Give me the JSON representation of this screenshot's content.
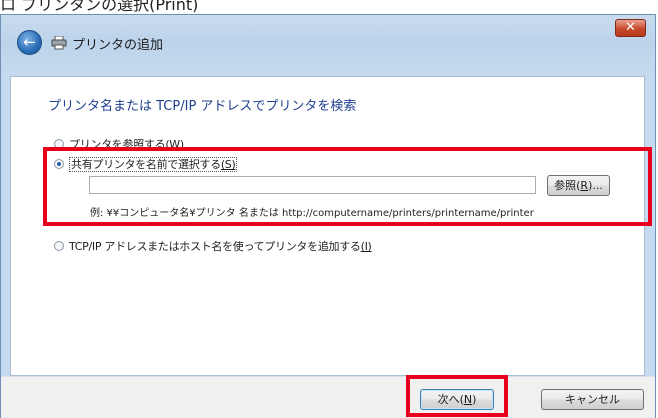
{
  "top_caption": "ロ ブリンタンの選択(Print)",
  "window": {
    "title": "プリンタの追加",
    "close_glyph": "✕",
    "back_glyph": "←"
  },
  "heading": "プリンタ名または TCP/IP アドレスでプリンタを検索",
  "options": {
    "browse": {
      "text": "プリンタを参照する",
      "accel": "(W)",
      "checked": false
    },
    "shared": {
      "text": "共有プリンタを名前で選択する",
      "accel": "(S)",
      "checked": true
    },
    "tcpip": {
      "text": "TCP/IP アドレスまたはホスト名を使ってプリンタを追加する",
      "accel": "(I)",
      "checked": false
    }
  },
  "shared_name": {
    "value": "",
    "placeholder": ""
  },
  "browse_button": {
    "text": "参照(",
    "accel": "R",
    "suffix": ")..."
  },
  "example_text": "例: ¥¥コンピュータ名¥プリンタ 名または http://computername/printers/printername/printer",
  "buttons": {
    "next": {
      "text": "次へ(",
      "accel": "N",
      "suffix": ")"
    },
    "cancel": "キャンセル"
  },
  "colors": {
    "highlight": "#e8001c",
    "heading": "#1f3f8f",
    "frame": "#c6dbef"
  }
}
